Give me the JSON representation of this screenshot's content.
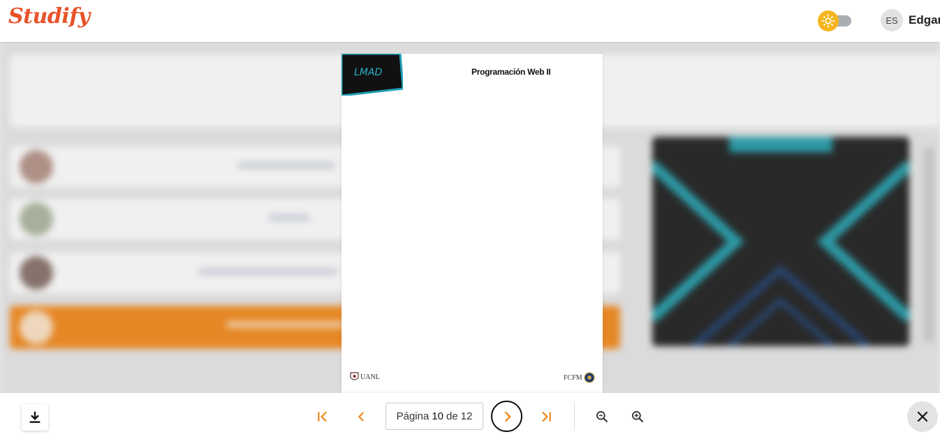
{
  "header": {
    "logo": "Studify",
    "user_initials": "ES",
    "user_name": "Edgar",
    "theme_icon": "sun-icon"
  },
  "document": {
    "logo_text": "LMAD",
    "title": "Programación Web II",
    "footer_left": "UANL",
    "footer_right": "FCFM"
  },
  "viewer": {
    "page_prefix": "Página",
    "current_page": "10",
    "page_of": "de",
    "total_pages": "12",
    "icons": {
      "download": "download-icon",
      "first": "first-page-icon",
      "prev": "chevron-left-icon",
      "next": "chevron-right-icon",
      "last": "last-page-icon",
      "zoom_out": "zoom-out-icon",
      "zoom_in": "zoom-in-icon",
      "close": "close-icon"
    }
  },
  "colors": {
    "brand": "#e8532a",
    "accent": "#f0861b",
    "toggle_sun": "#f6b51e",
    "lesson_active": "#f59028"
  }
}
